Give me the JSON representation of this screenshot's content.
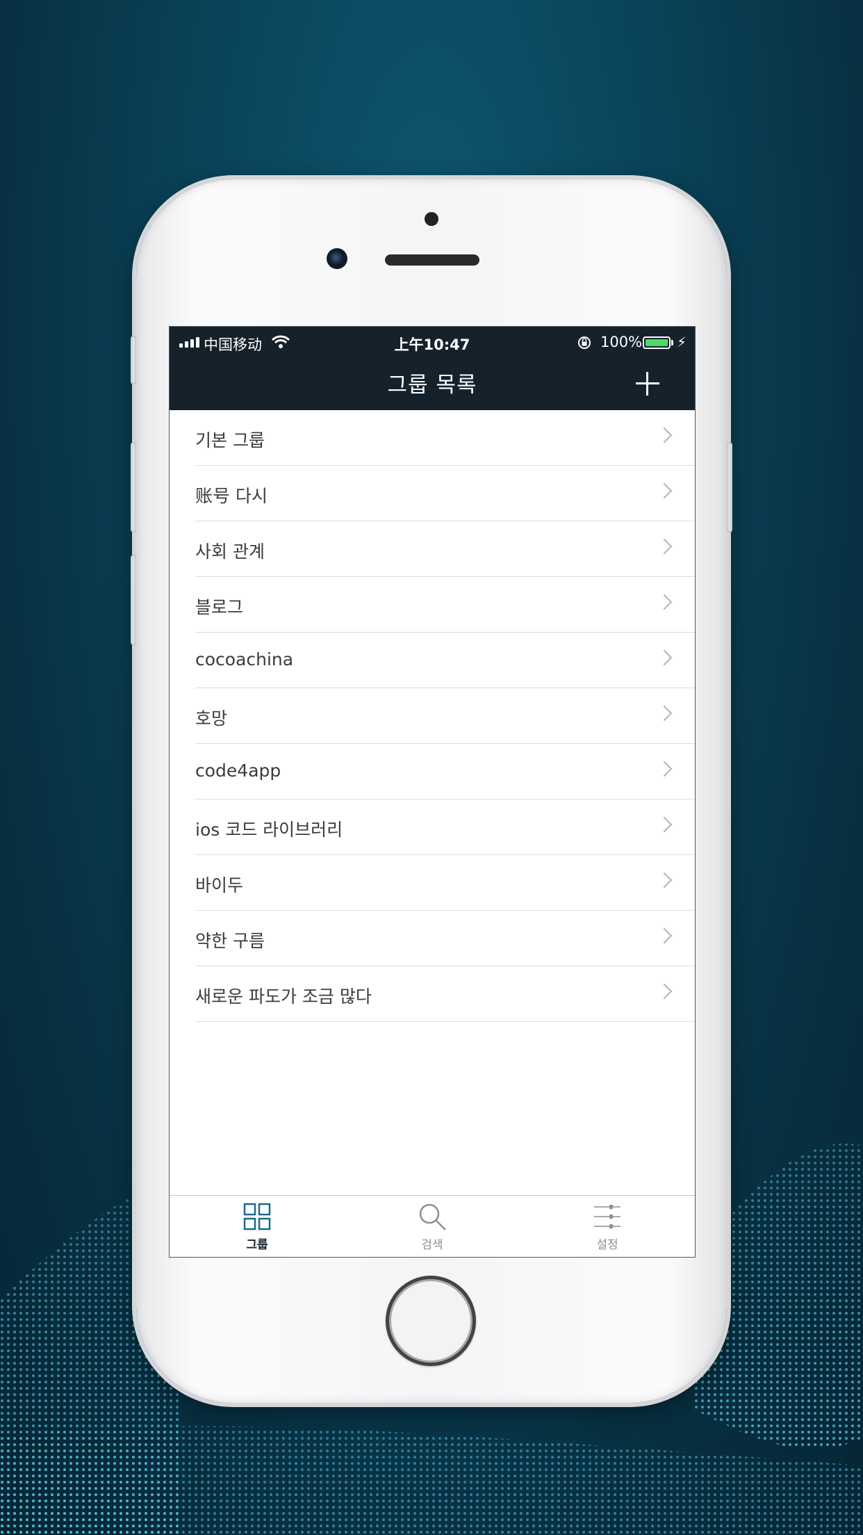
{
  "status_bar": {
    "carrier": "中国移动",
    "time": "上午10:47",
    "battery": "100%"
  },
  "nav": {
    "title": "그룹 목록",
    "add_icon": "plus-icon"
  },
  "groups": [
    {
      "label": "기본 그룹"
    },
    {
      "label": "账号 다시"
    },
    {
      "label": "사회 관계"
    },
    {
      "label": "블로그"
    },
    {
      "label": "cocoachina"
    },
    {
      "label": "호망"
    },
    {
      "label": "code4app"
    },
    {
      "label": "ios 코드 라이브러리"
    },
    {
      "label": "바이두"
    },
    {
      "label": "약한 구름"
    },
    {
      "label": "새로운 파도가 조금 많다"
    }
  ],
  "tabs": [
    {
      "label": "그룹",
      "icon": "grid-icon",
      "active": true
    },
    {
      "label": "검색",
      "icon": "search-icon",
      "active": false
    },
    {
      "label": "설정",
      "icon": "sliders-icon",
      "active": false
    }
  ],
  "colors": {
    "nav_bg": "#15222b",
    "active_tab": "#1a6a8e",
    "inactive_tab": "#8e8e93",
    "battery_green": "#4cd964"
  }
}
